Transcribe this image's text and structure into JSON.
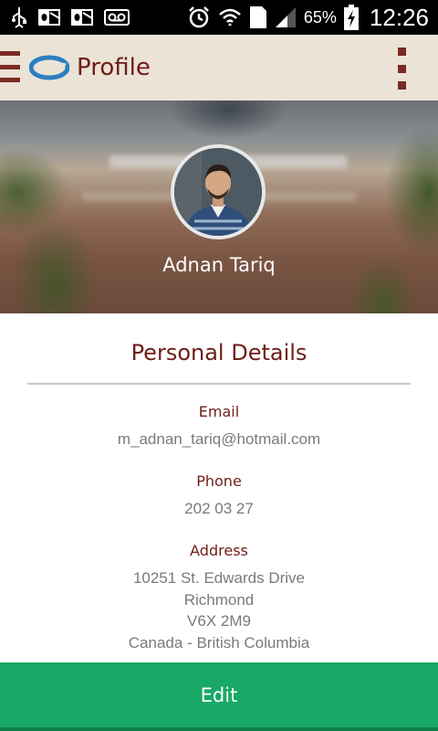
{
  "status_bar": {
    "icons": [
      "usb-icon",
      "outlook-icon",
      "outlook-icon",
      "voicemail-icon",
      "alarm-icon",
      "wifi-icon",
      "sim-icon",
      "signal-icon",
      "battery-charging-icon"
    ],
    "sim_slot": "1",
    "battery": "65%",
    "time": "12:26"
  },
  "app_bar": {
    "title": "Profile",
    "icons": [
      "menu-icon",
      "app-logo",
      "overflow-menu-icon"
    ],
    "accent_color": "#6e1d17",
    "background_color": "#ebe3d6"
  },
  "profile": {
    "name": "Adnan Tariq"
  },
  "details": {
    "title": "Personal Details",
    "email_label": "Email",
    "email_value": "m_adnan_tariq@hotmail.com",
    "phone_label": "Phone",
    "phone_value": "202 03 27",
    "address_label": "Address",
    "address_lines": [
      "10251 St. Edwards Drive",
      "Richmond",
      "V6X 2M9",
      "Canada - British Columbia"
    ]
  },
  "actions": {
    "edit_label": "Edit",
    "edit_color": "#19a866"
  }
}
